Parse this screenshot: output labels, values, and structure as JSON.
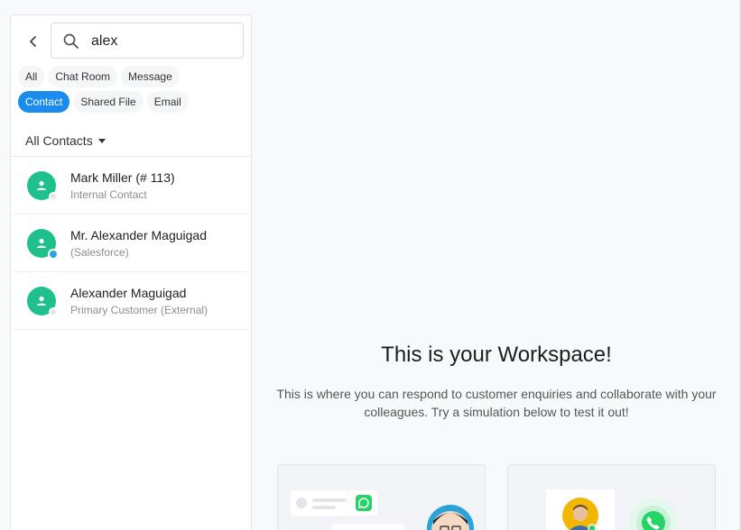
{
  "search": {
    "query": "alex",
    "back_icon": "chevron-left-icon",
    "search_icon": "search-icon"
  },
  "filters": [
    {
      "label": "All",
      "active": false
    },
    {
      "label": "Chat Room",
      "active": false
    },
    {
      "label": "Message",
      "active": false
    },
    {
      "label": "Contact",
      "active": true
    },
    {
      "label": "Shared File",
      "active": false
    },
    {
      "label": "Email",
      "active": false
    }
  ],
  "contacts_dropdown": {
    "label": "All Contacts"
  },
  "results": [
    {
      "name": "Mark Miller (# 113)",
      "subtitle": "Internal Contact",
      "status": "offline"
    },
    {
      "name": "Mr. Alexander Maguigad",
      "subtitle": "(Salesforce)",
      "status": "chat"
    },
    {
      "name": "Alexander Maguigad",
      "subtitle": "Primary Customer (External)",
      "status": "offline"
    }
  ],
  "workspace": {
    "title": "This is your Workspace!",
    "description": "This is where you can respond to customer enquiries and collaborate with your colleagues. Try a simulation below to test it out!"
  },
  "colors": {
    "accent": "#1a8cf0",
    "avatar": "#20c08c",
    "whatsapp": "#25d366"
  }
}
